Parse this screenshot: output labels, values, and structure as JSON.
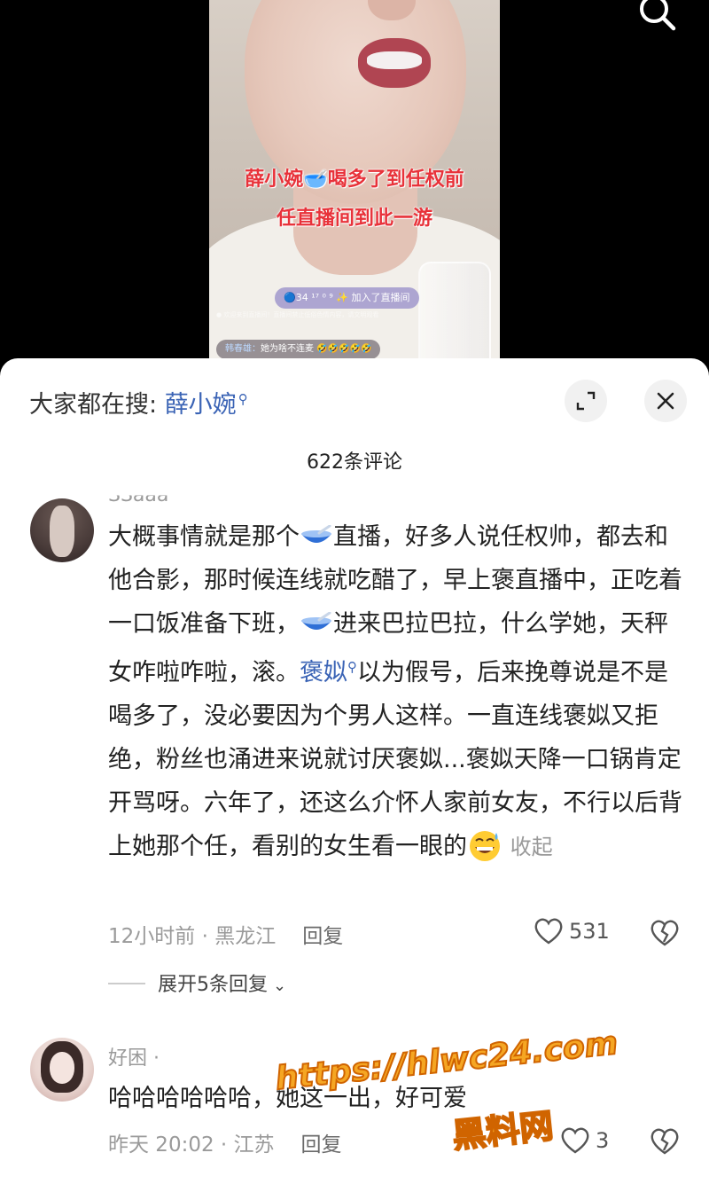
{
  "video": {
    "overlay_line1": "薛小婉🥣喝多了到任权前",
    "overlay_line2": "任直播间到此一游",
    "join_text": "🔵34 ¹⁷ ⁰ ⁹ ✨ 加入了直播间",
    "live_note": "● 欢迎来到直播间！直播间禁止低俗色情内容，请文明观看",
    "chat_name": "韩春雄：",
    "chat_text": "她为啥不连麦 🤣🤣🤣🤣🤣"
  },
  "sheet": {
    "search_prefix": "大家都在搜: ",
    "search_keyword": "薛小婉",
    "comment_count": "622条评论"
  },
  "comments": [
    {
      "username": "SSaaa",
      "text_1": "大概事情就是那个",
      "text_2": "直播，好多人说任权帅，都去和他合影，那时候连线就吃醋了，早上褒直播中，正吃着一口饭准备下班，",
      "text_3": "进来巴拉巴拉，什么学她，天秤女咋啦咋啦，滚。",
      "keyword": "褒姒",
      "text_4": "以为假号，后来挽尊说是不是喝多了，没必要因为个男人这样。一直连线褒姒又拒绝，粉丝也涌进来说就讨厌褒姒...褒姒天降一口锅肯定开骂呀。六年了，还这么介怀人家前女友，不行以后背上她那个任，看别的女生看一眼的",
      "collapse": "收起",
      "time_location": "12小时前 · 黑龙江",
      "reply": "回复",
      "likes": "531",
      "expand_replies": "展开5条回复"
    },
    {
      "username": "好困 ·",
      "text": "哈哈哈哈哈哈，她这一出，好可爱",
      "time_location": "昨天 20:02 · 江苏",
      "reply": "回复",
      "likes": "3"
    }
  ],
  "watermark": {
    "url": "https://hlwc24.com",
    "site": "黑料网"
  }
}
